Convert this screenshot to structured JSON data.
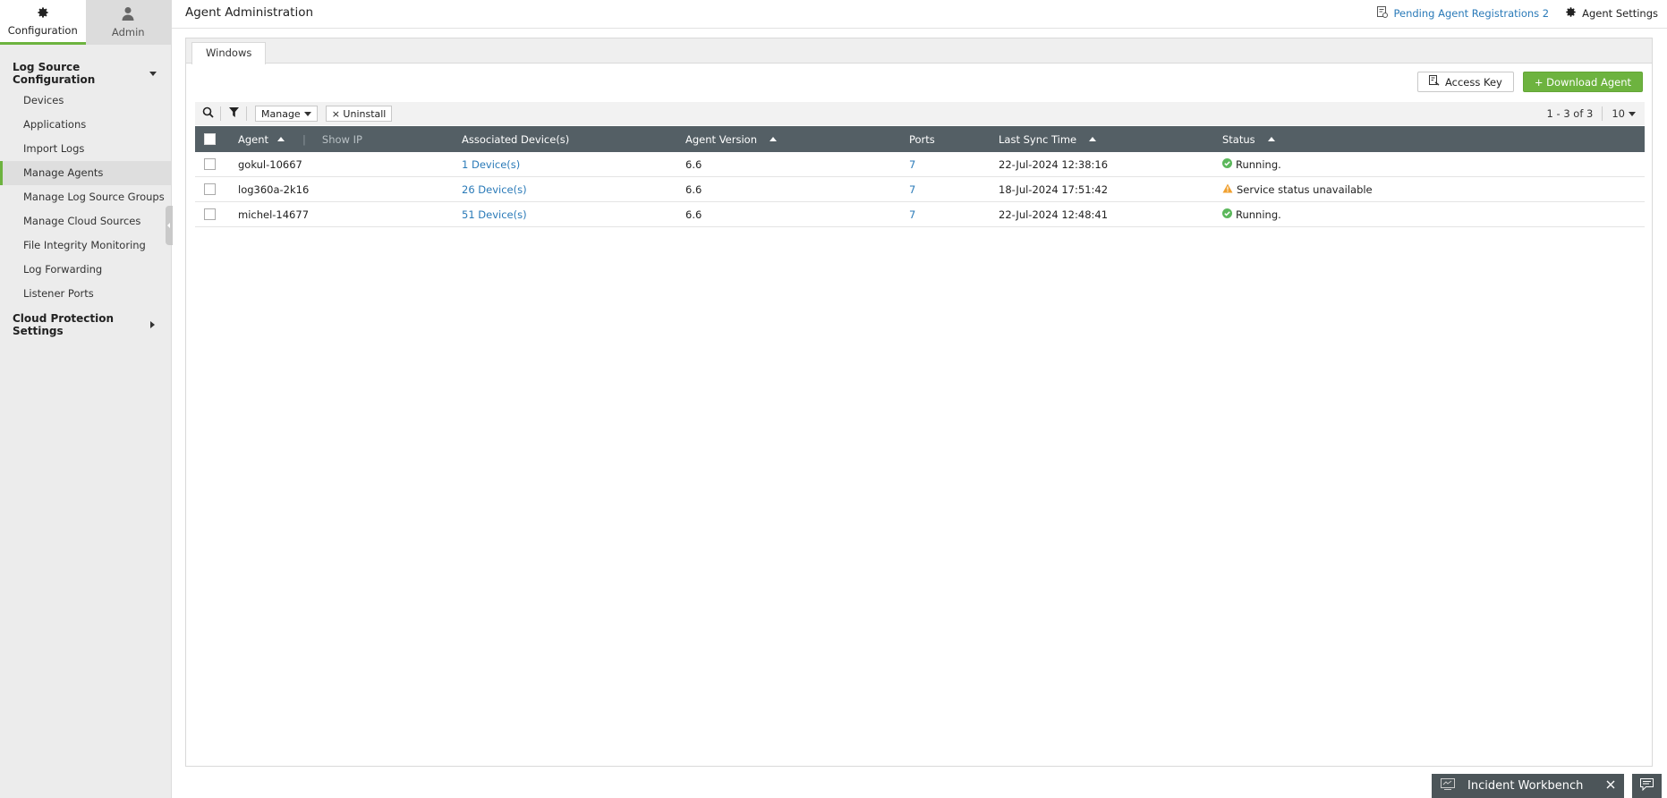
{
  "sidebar": {
    "top_tabs": [
      {
        "label": "Configuration",
        "icon": "gear-icon",
        "active": true
      },
      {
        "label": "Admin",
        "icon": "user-icon",
        "active": false
      }
    ],
    "sections": [
      {
        "label": "Log Source Configuration",
        "expanded": true,
        "items": [
          {
            "label": "Devices"
          },
          {
            "label": "Applications"
          },
          {
            "label": "Import Logs"
          },
          {
            "label": "Manage Agents",
            "active": true
          },
          {
            "label": "Manage Log Source Groups"
          },
          {
            "label": "Manage Cloud Sources"
          },
          {
            "label": "File Integrity Monitoring"
          },
          {
            "label": "Log Forwarding"
          },
          {
            "label": "Listener Ports"
          }
        ]
      },
      {
        "label": "Cloud Protection Settings",
        "expanded": false
      }
    ]
  },
  "header": {
    "title": "Agent Administration",
    "pending_label": "Pending Agent Registrations 2",
    "settings_label": "Agent Settings"
  },
  "tabs": [
    {
      "label": "Windows",
      "active": true
    }
  ],
  "actions": {
    "access_key": "Access Key",
    "download_agent": "+ Download Agent"
  },
  "toolbar": {
    "manage_label": "Manage",
    "uninstall_label": "× Uninstall",
    "page_info": "1 - 3 of 3",
    "page_size": "10"
  },
  "table": {
    "columns": {
      "agent": "Agent",
      "show_ip": "Show IP",
      "associated": "Associated Device(s)",
      "version": "Agent Version",
      "ports": "Ports",
      "last_sync": "Last Sync Time",
      "status": "Status"
    },
    "rows": [
      {
        "agent": "gokul-10667",
        "devices": "1 Device(s)",
        "version": "6.6",
        "ports": "7",
        "last_sync": "22-Jul-2024 12:38:16",
        "status": "Running.",
        "status_kind": "ok"
      },
      {
        "agent": "log360a-2k16",
        "devices": "26 Device(s)",
        "version": "6.6",
        "ports": "7",
        "last_sync": "18-Jul-2024 17:51:42",
        "status": "Service status unavailable",
        "status_kind": "warn"
      },
      {
        "agent": "michel-14677",
        "devices": "51 Device(s)",
        "version": "6.6",
        "ports": "7",
        "last_sync": "22-Jul-2024 12:48:41",
        "status": "Running.",
        "status_kind": "ok"
      }
    ]
  },
  "footer": {
    "workbench_label": "Incident Workbench"
  },
  "colors": {
    "accent_green": "#6db33f",
    "header_dark": "#545f65",
    "link_blue": "#2a7ab8",
    "ok_green": "#5cb85c",
    "warn_orange": "#f0a030"
  }
}
